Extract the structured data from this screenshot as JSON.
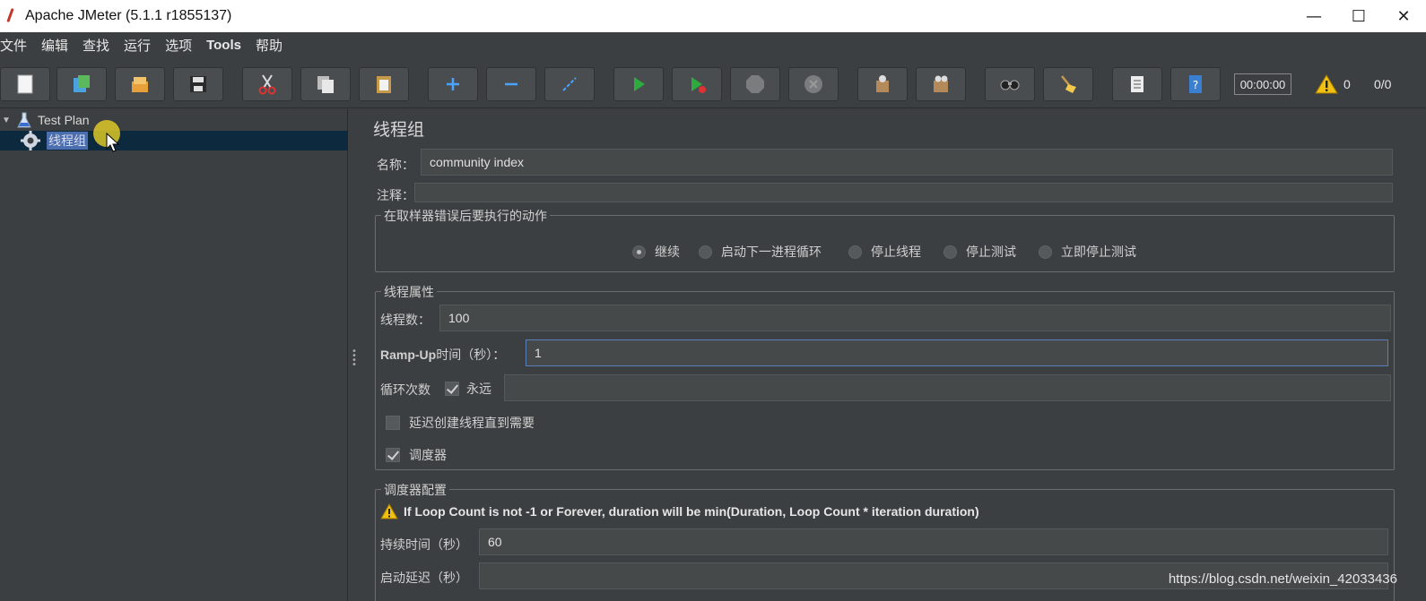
{
  "window": {
    "title": "Apache JMeter (5.1.1 r1855137)"
  },
  "menu": [
    "文件",
    "编辑",
    "查找",
    "运行",
    "选项",
    "Tools",
    "帮助"
  ],
  "toolbar": {
    "buttons": [
      "new-icon",
      "templates-icon",
      "open-icon",
      "save-icon",
      "cut-icon",
      "copy-icon",
      "paste-icon",
      "expand-icon",
      "collapse-icon",
      "toggle-icon",
      "start-icon",
      "start-no-pause-icon",
      "stop-icon",
      "shutdown-icon",
      "clear-icon",
      "clear-all-icon",
      "search-icon",
      "reset-search-icon",
      "function-helper-icon",
      "help-icon"
    ],
    "timer": "00:00:00",
    "warning_count": "0",
    "thread_count": "0/0"
  },
  "tree": {
    "root": "Test Plan",
    "child": "线程组"
  },
  "panel": {
    "title": "线程组",
    "name_label": "名称：",
    "name_value": "community index",
    "comment_label": "注释：",
    "comment_value": "",
    "error_group_title": "在取样器错误后要执行的动作",
    "error_options": [
      "继续",
      "启动下一进程循环",
      "停止线程",
      "停止测试",
      "立即停止测试"
    ],
    "error_selected": "继续",
    "thread_props_title": "线程属性",
    "threads_label": "线程数：",
    "threads_value": "100",
    "rampup_label_bold": "Ramp-Up",
    "rampup_label_rest": "时间（秒）：",
    "rampup_value": "1",
    "loop_label": "循环次数",
    "forever_label": "永远",
    "forever_checked": true,
    "delay_label": "延迟创建线程直到需要",
    "delay_checked": false,
    "scheduler_label": "调度器",
    "scheduler_checked": true,
    "scheduler_config_title": "调度器配置",
    "scheduler_warning": "If Loop Count is not -1 or Forever, duration will be min(Duration, Loop Count * iteration duration)",
    "duration_label": "持续时间（秒）",
    "duration_value": "60",
    "startup_delay_label": "启动延迟（秒）",
    "startup_delay_value": ""
  },
  "watermark": "https://blog.csdn.net/weixin_42033436"
}
